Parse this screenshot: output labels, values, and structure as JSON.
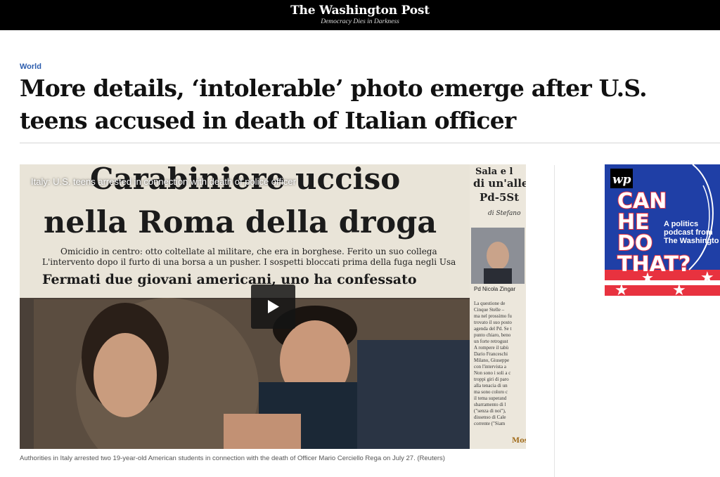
{
  "header": {
    "logo": "The Washington Post",
    "tagline": "Democracy Dies in Darkness"
  },
  "article": {
    "section": "World",
    "headline": "More details, ‘intolerable’ photo emerge after U.S. teens accused in death of Italian officer"
  },
  "video": {
    "title": "Italy: U.S. teens arrested in connection with death of police officer",
    "caption": "Authorities in Italy arrested two 19-year-old American students in connection with the death of Officer Mario Cerciello Rega on July 27. (Reuters)",
    "newspaper": {
      "headline_line1": "Carabiniere ucciso",
      "headline_line2": "nella Roma della droga",
      "sub1": "Omicidio in centro: otto coltellate al militare, che era in borghese. Ferito un suo collega",
      "sub2": "L'intervento dopo il furto di una borsa a un pusher. I sospetti bloccati prima della fuga negli Usa",
      "bold_sub": "Fermati due giovani americani, uno ha confessato",
      "side_top1": "Sala e l",
      "side_top2": "di un'alle",
      "side_top3": "Pd-5St",
      "side_byline": "di Stefano",
      "side_photo_label": "Pd Nicola Zingar",
      "side_col": [
        "La questione de",
        "Cinque Stelle –",
        "ma nel prossimo fu",
        "trovato il suo posto",
        "agenda del Pd. Se t",
        "punto chiaro, beno",
        "un forte retrogust",
        "A rompere il tabù",
        "Dario Franceschi",
        "Milano, Giuseppe",
        "con l'intervista a",
        "Non sono i soli a c",
        "troppi giri di paro",
        "alla tenacia di un",
        "ma sono coloro c",
        "il tema superand",
        "sbarramento di l",
        "(\"senza di noi\"),",
        "dissenso di Cale",
        "corrente (\"Siam"
      ],
      "side_bottom": "Mos"
    }
  },
  "ad": {
    "logo": "wp",
    "title_lines": [
      "CAN",
      "HE",
      "DO",
      "THAT?"
    ],
    "subtitle_lines": [
      "A politics",
      "podcast from",
      "The Washingto"
    ],
    "colors": {
      "blue": "#1f3fa6",
      "red": "#e8323f",
      "white": "#ffffff"
    }
  },
  "icons": {
    "play": "play-icon"
  }
}
